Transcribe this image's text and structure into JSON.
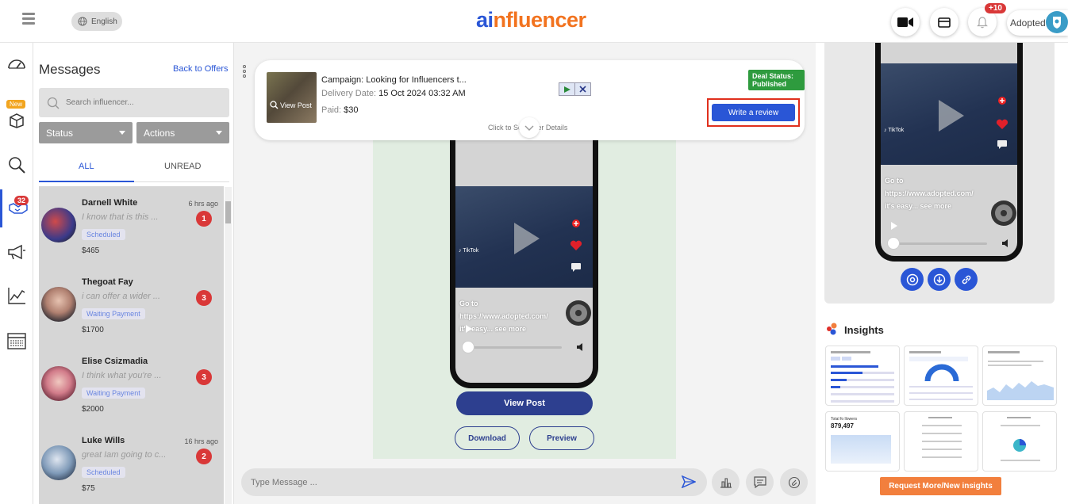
{
  "header": {
    "language": "English",
    "logo_a": "ai",
    "logo_rest": "nfluencer",
    "notification_count": "+10",
    "account_name": "Adopted"
  },
  "rail": {
    "new_tag": "New",
    "messages_badge": "32"
  },
  "messages": {
    "title": "Messages",
    "back_link": "Back to Offers",
    "search_placeholder": "Search influencer...",
    "status_dropdown": "Status",
    "actions_dropdown": "Actions",
    "tab_all": "ALL",
    "tab_unread": "UNREAD",
    "conversations": [
      {
        "name": "Darnell White",
        "time": "6 hrs ago",
        "preview": "I know that is this ...",
        "status": "Scheduled",
        "price": "$465",
        "count": "1"
      },
      {
        "name": "Thegoat Fay",
        "time": "",
        "preview": "i can offer a wider ...",
        "status": "Waiting Payment",
        "price": "$1700",
        "count": "3"
      },
      {
        "name": "Elise Csizmadia",
        "time": "",
        "preview": "I think what you're ...",
        "status": "Waiting Payment",
        "price": "$2000",
        "count": "3"
      },
      {
        "name": "Luke Wills",
        "time": "16 hrs ago",
        "preview": "great Iam going to c...",
        "status": "Scheduled",
        "price": "$75",
        "count": "2"
      }
    ]
  },
  "offer": {
    "view_post": "View Post",
    "campaign": "Campaign: Looking for Influencers t...",
    "delivery_label": "Delivery Date:",
    "delivery_value": "15 Oct 2024 03:32 AM",
    "paid_label": "Paid:",
    "paid_value": "$30",
    "click_hint": "Click to See Offer Details",
    "deal_status": "Deal Status: Published",
    "write_review": "Write a review"
  },
  "post": {
    "overlay_line1": "Go to",
    "overlay_line2": "https://www.adopted.com/",
    "overlay_line3": "it's easy... see more",
    "tiktok_label": "TikTok",
    "view_post_button": "View Post",
    "download_button": "Download",
    "preview_button": "Preview"
  },
  "composer": {
    "placeholder": "Type Message ..."
  },
  "right": {
    "overlay_line1": "Go to",
    "overlay_line2": "https://www.adopted.com/",
    "overlay_line3": "it's easy... see more",
    "insights_title": "Insights",
    "request_button": "Request More/New insights",
    "total_followers_label": "Total fo llowers",
    "total_followers_value": "879,497"
  }
}
